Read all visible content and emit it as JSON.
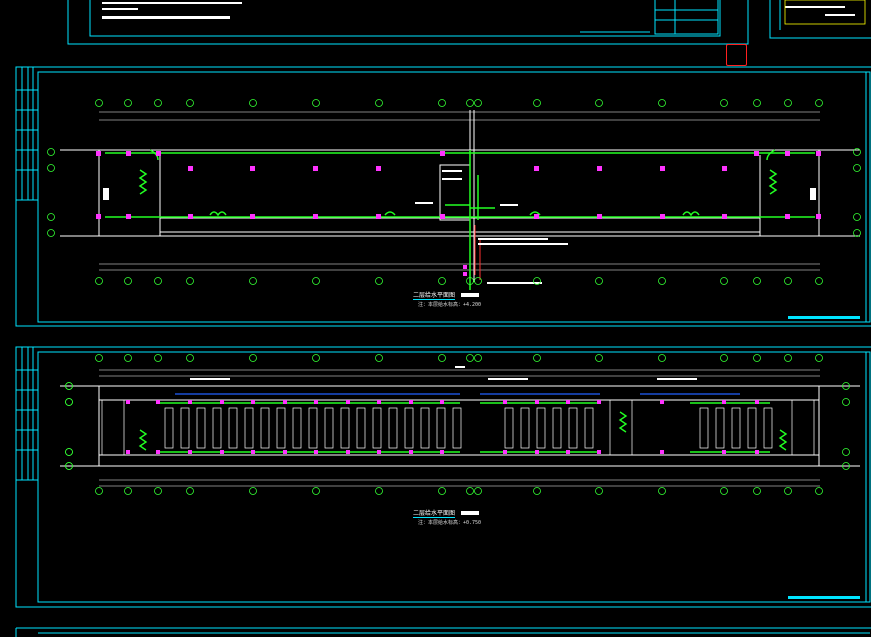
{
  "drawing": {
    "colors": {
      "background": "#000000",
      "frame": "#00e5ff",
      "pipe": "#22ff22",
      "wall": "#ffffff",
      "fixture": "#ff33ff",
      "text": "#ffffff",
      "highlight": "#ffff00",
      "cursor": "#ff2020"
    },
    "plan_top": {
      "title": "二层给水平面图",
      "note": "注：本层给水标高：+4.200"
    },
    "plan_bottom": {
      "title": "二层给水平面图",
      "note": "注：本层给水标高：+0.750"
    },
    "top_sheet_notes": [
      "设计说明",
      "给排水施工说明",
      "图例"
    ],
    "pipe_labels": [
      "JL-1",
      "JL-2",
      "DN50",
      "DN32"
    ]
  }
}
